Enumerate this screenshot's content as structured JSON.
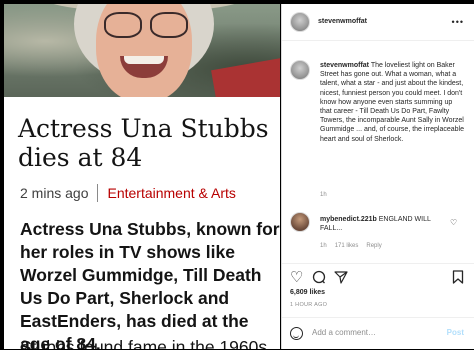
{
  "article": {
    "headline": "Actress Una Stubbs dies at 84",
    "time": "2 mins ago",
    "category": "Entertainment & Arts",
    "summary": "Actress Una Stubbs, known for her roles in TV shows like Worzel Gummidge, Till Death Us Do Part, Sherlock and EastEnders, has died at the age of 84.",
    "next_paragraph_start": "Stubbs found fame in the 1960s"
  },
  "post": {
    "username": "stevenwmoffat",
    "more_icon": "more-horizontal-icon",
    "caption_user": "stevenwmoffat",
    "caption_text": " The loveliest light on Baker Street has gone out. What a woman, what a talent, what a star - and just about the kindest, nicest, funniest person you could meet. I don't know how anyone even starts summing up that career - Till Death Us Do Part, Fawlty Towers, the incomparable Aunt Sally in Worzel Gummidge ... and, of course, the irreplaceable heart and soul of Sherlock.",
    "caption_time": "1h",
    "comments": [
      {
        "user": "mybenedict.221b",
        "text": " ENGLAND WILL FALL...",
        "time": "1h",
        "likes": "171 likes",
        "reply": "Reply"
      }
    ],
    "actions": {
      "like_icon": "heart-icon",
      "comment_icon": "comment-icon",
      "share_icon": "send-icon",
      "save_icon": "bookmark-icon"
    },
    "likes_count": "6,809 likes",
    "posted_ago": "1 HOUR AGO",
    "add_comment_placeholder": "Add a comment…",
    "post_button": "Post"
  },
  "colors": {
    "bbc_red": "#b80000",
    "instagram_text": "#262626",
    "instagram_muted": "#8e8e8e",
    "post_disabled": "#b2dffc"
  }
}
